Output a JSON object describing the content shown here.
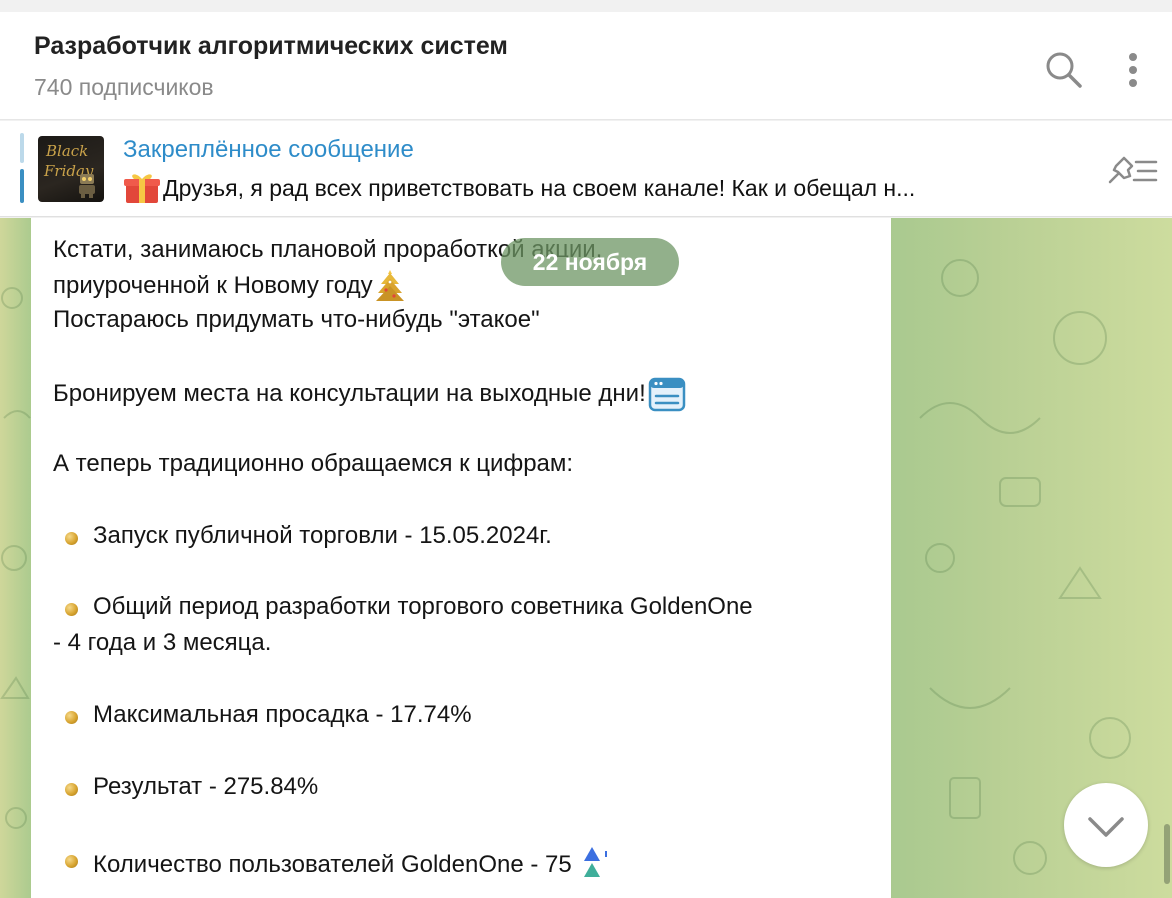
{
  "header": {
    "channel_title": "Разработчик алгоритмических систем",
    "subscribers": "740 подписчиков",
    "search_icon": "search-icon",
    "more_icon": "more-vertical-icon"
  },
  "pinned": {
    "label": "Закреплённое сообщение",
    "text": "Друзья, я рад всех приветствовать на своем канале!  Как и обещал н...",
    "thumbnail_line1": "Black",
    "thumbnail_line2": "Friday",
    "action_icon": "pinned-list-icon"
  },
  "date_pill": "22 ноября",
  "message": {
    "line1": "Кстати, занимаюсь плановой проработкой акции,",
    "line2": "приуроченной к Новому году",
    "line3": "Постараюсь придумать что-нибудь \"этакое\"",
    "line4": "Бронируем места на консультации на выходные дни!",
    "line5": "А теперь традиционно обращаемся к цифрам:",
    "bullets": [
      "Запуск публичной торговли - 15.05.2024г.",
      "Общий период разработки торгового советника GoldenOne",
      "Максимальная просадка - 17.74%",
      "Результат - 275.84%",
      "Количество пользователей GoldenOne - 75"
    ],
    "bullet2_cont": "- 4  года и 3 месяца."
  },
  "colors": {
    "accent": "#2e8cc9",
    "title": "#222222",
    "muted": "#8a8a8a"
  }
}
